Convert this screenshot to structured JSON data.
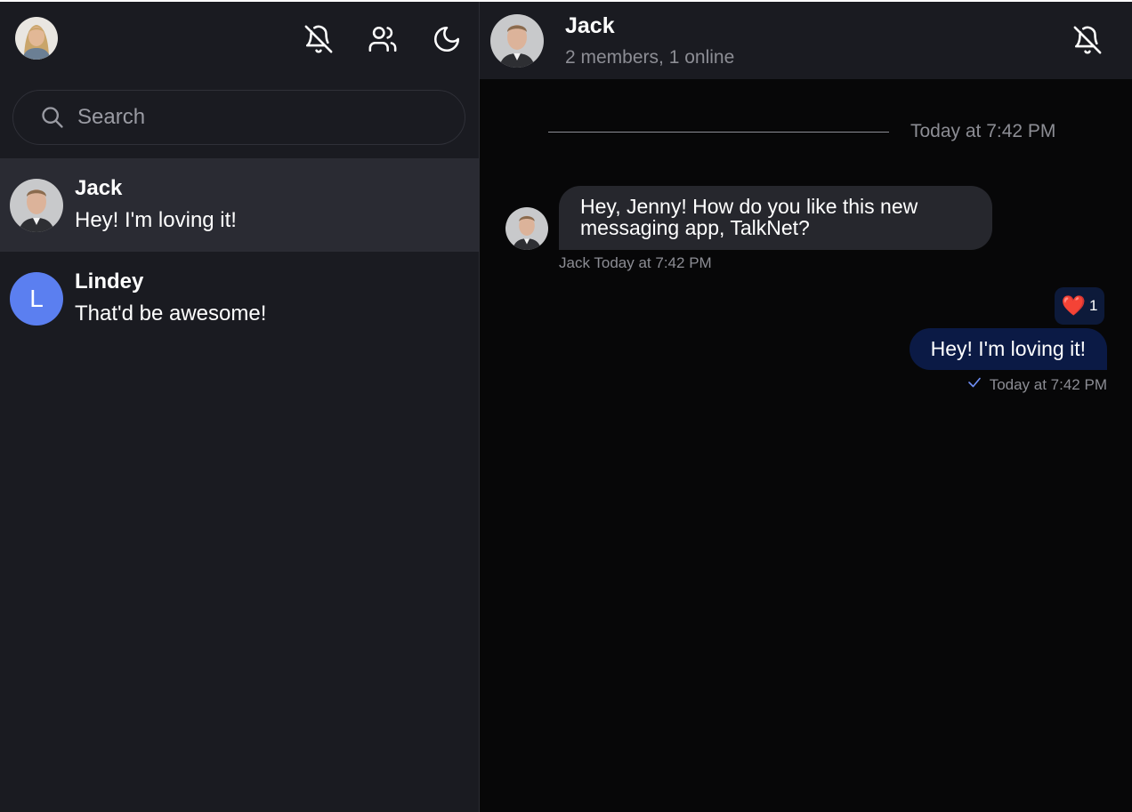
{
  "sidebar": {
    "current_user_avatar": "avatar-photo-woman-blonde",
    "header_icons": [
      "bell-off-icon",
      "users-icon",
      "moon-icon"
    ],
    "search": {
      "placeholder": "Search",
      "value": ""
    },
    "channels": [
      {
        "name": "Jack",
        "preview": "Hey! I'm loving it!",
        "avatar": "avatar-photo-man",
        "active": true
      },
      {
        "name": "Lindey",
        "preview": "That'd be awesome!",
        "avatar_letter": "L",
        "avatar_color": "#5b7ff0",
        "active": false
      }
    ]
  },
  "chat": {
    "title": "Jack",
    "subtitle": "2 members, 1 online",
    "date_separator": "Today at 7:42 PM",
    "messages": [
      {
        "direction": "incoming",
        "text": "Hey, Jenny! How do you like this new messaging app, TalkNet?",
        "author": "Jack",
        "time": "Today at 7:42 PM"
      },
      {
        "direction": "outgoing",
        "text": "Hey! I'm loving it!",
        "time": "Today at 7:42 PM",
        "status": "sent-check-icon",
        "reaction": {
          "emoji": "❤️",
          "count": "1"
        }
      }
    ]
  },
  "colors": {
    "sidebar_bg": "#1a1b21",
    "chat_bg": "#070708",
    "active_row": "#2a2b33",
    "incoming_bubble": "#26272d",
    "outgoing_bubble": "#0b1a45",
    "accent": "#5b7ff0"
  }
}
